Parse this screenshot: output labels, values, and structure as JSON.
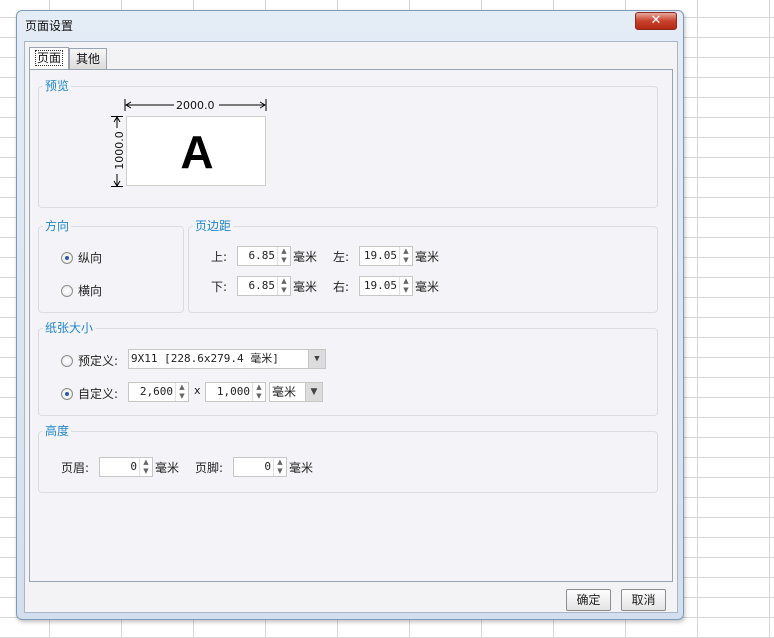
{
  "dialog": {
    "title": "页面设置",
    "close_label": "✕",
    "tabs": [
      "页面",
      "其他"
    ]
  },
  "preview": {
    "title": "预览",
    "width_label": "2000.0",
    "height_label": "1000.0",
    "letter": "A"
  },
  "orientation": {
    "title": "方向",
    "options": [
      "纵向",
      "横向"
    ],
    "selected": "纵向"
  },
  "margins": {
    "title": "页边距",
    "top_label": "上:",
    "top_value": "6.85",
    "bottom_label": "下:",
    "bottom_value": "6.85",
    "left_label": "左:",
    "left_value": "19.05",
    "right_label": "右:",
    "right_value": "19.05",
    "unit": "毫米"
  },
  "paper": {
    "title": "纸张大小",
    "predefined_label": "预定义:",
    "predefined_value": "9X11 [228.6x279.4 毫米]",
    "custom_label": "自定义:",
    "custom_width": "2,600",
    "times": "x",
    "custom_height": "1,000",
    "unit_value": "毫米",
    "selected": "自定义"
  },
  "height": {
    "title": "高度",
    "header_label": "页眉:",
    "header_value": "0",
    "footer_label": "页脚:",
    "footer_value": "0",
    "unit": "毫米"
  },
  "buttons": {
    "ok": "确定",
    "cancel": "取消"
  },
  "icons": {
    "close": "close-icon",
    "spin": "spin-arrows-icon",
    "dropdown": "chevron-down-icon"
  }
}
